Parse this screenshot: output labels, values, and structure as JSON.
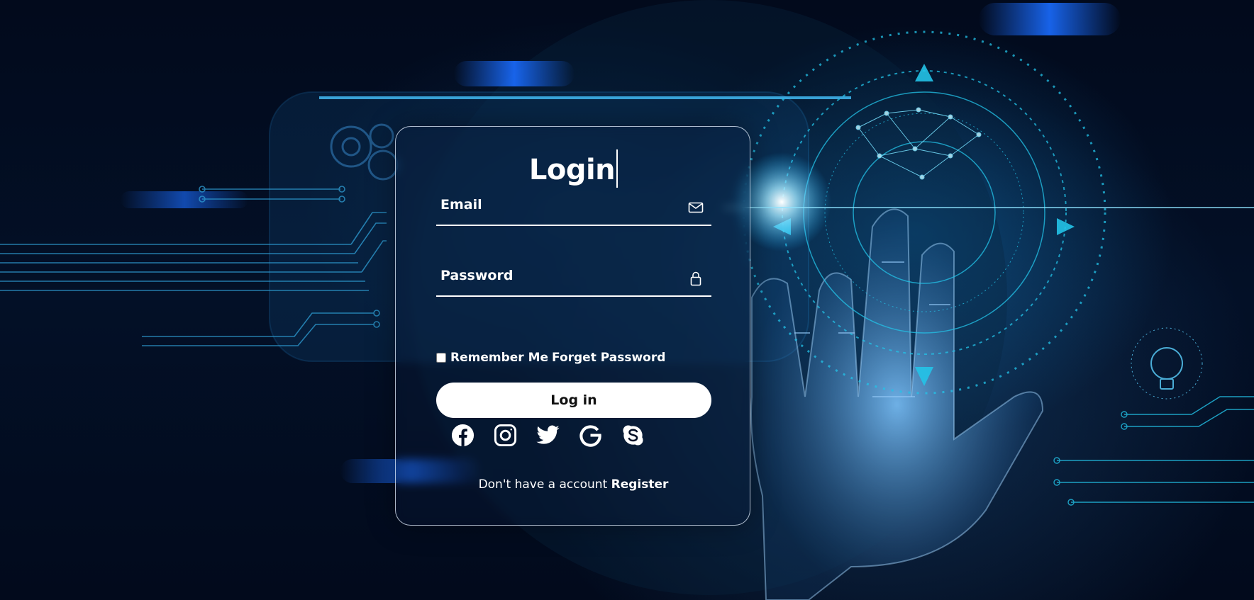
{
  "login": {
    "title": "Login",
    "email": {
      "placeholder": "Email",
      "value": ""
    },
    "password": {
      "placeholder": "Password",
      "value": ""
    },
    "remember_label": "Remember Me",
    "forget_label": "Forget Password",
    "login_button": "Log in",
    "socials": [
      {
        "icon": "facebook-icon"
      },
      {
        "icon": "instagram-icon"
      },
      {
        "icon": "twitter-icon"
      },
      {
        "icon": "google-icon"
      },
      {
        "icon": "skype-icon"
      }
    ],
    "register_prompt": "Don't have a account",
    "register_link": "Register"
  },
  "theme": {
    "background": "#020a1c",
    "accent": "#1ab4ff",
    "text": "#ffffff",
    "button_bg": "#ffffff",
    "button_text": "#111111"
  }
}
